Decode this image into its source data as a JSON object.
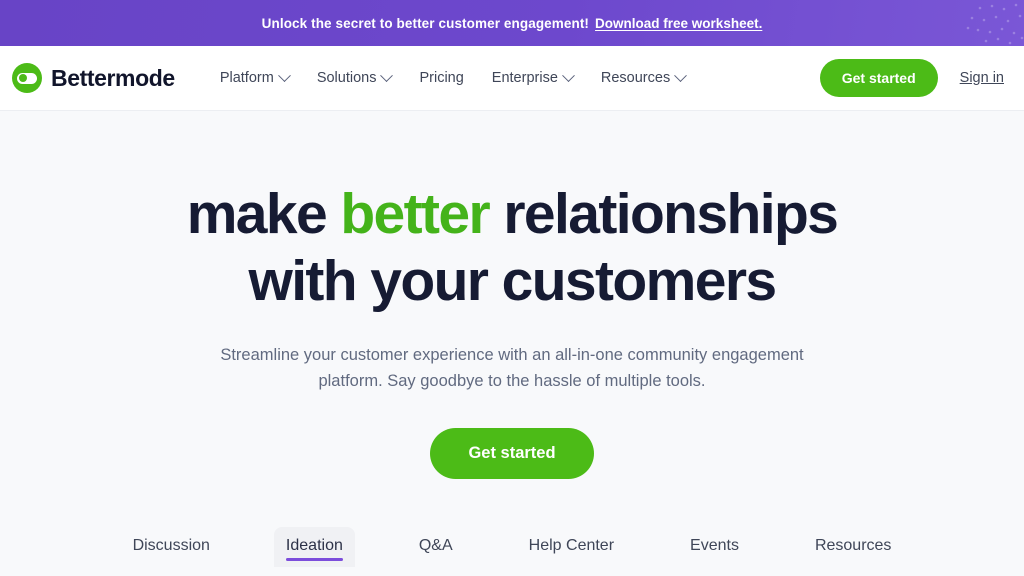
{
  "colors": {
    "banner_purple": "#6a45c8",
    "brand_green": "#4cbb17",
    "headline_green": "#44b31a",
    "headline_navy": "#161b33",
    "hero_background": "#f8f9fb",
    "tab_active_underline": "#7c4ddb"
  },
  "promo_banner": {
    "text": "Unlock the secret to better customer engagement!",
    "link_label": "Download free worksheet.",
    "decoration_icon": "dot-pattern-icon"
  },
  "header": {
    "logo_icon": "bettermode-toggle-logo-icon",
    "brand_name": "Bettermode",
    "nav_items": [
      {
        "label": "Platform",
        "has_dropdown": true
      },
      {
        "label": "Solutions",
        "has_dropdown": true
      },
      {
        "label": "Pricing",
        "has_dropdown": false
      },
      {
        "label": "Enterprise",
        "has_dropdown": true
      },
      {
        "label": "Resources",
        "has_dropdown": true
      }
    ],
    "get_started_label": "Get started",
    "sign_in_label": "Sign in"
  },
  "hero": {
    "title_part1": "make ",
    "title_highlight": "better",
    "title_part2": " relationships",
    "title_line2": "with your customers",
    "subtitle": "Streamline your customer experience with an all-in-one community engagement platform. Say goodbye to the hassle of multiple tools.",
    "cta_label": "Get started"
  },
  "tabs": [
    {
      "label": "Discussion",
      "active": false
    },
    {
      "label": "Ideation",
      "active": true
    },
    {
      "label": "Q&A",
      "active": false
    },
    {
      "label": "Help Center",
      "active": false
    },
    {
      "label": "Events",
      "active": false
    },
    {
      "label": "Resources",
      "active": false
    }
  ]
}
